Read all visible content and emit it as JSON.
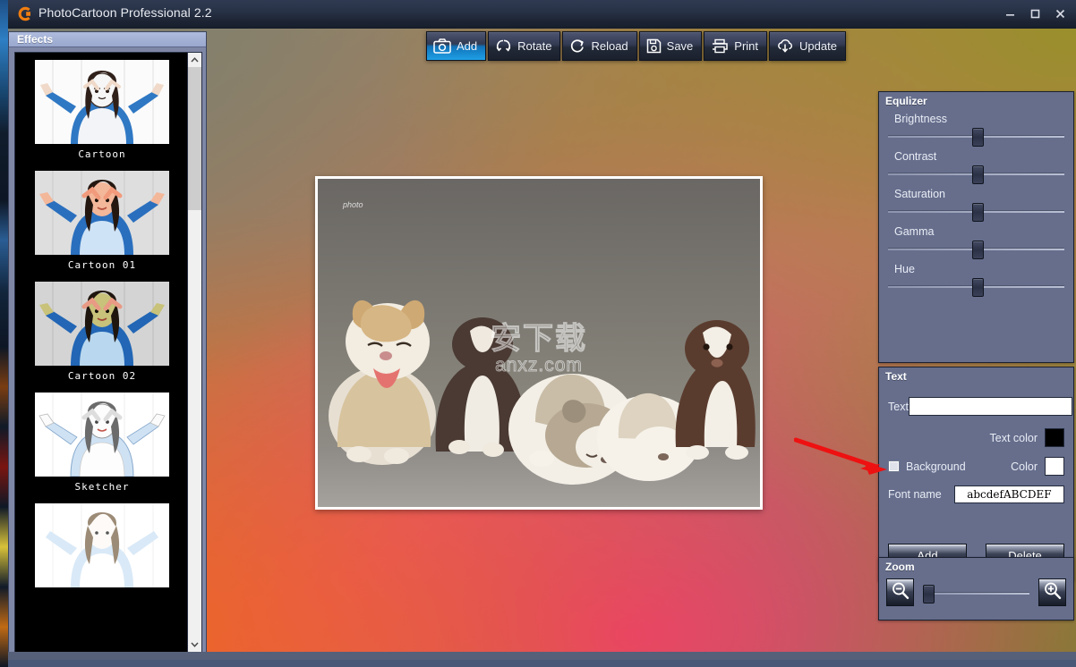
{
  "window": {
    "title": "PhotoCartoon Professional 2.2",
    "logo_icon": "app-logo-icon",
    "minimize_label": "–",
    "maximize_label": "□",
    "close_label": "✕"
  },
  "toolbar": {
    "buttons": [
      {
        "label": "Add",
        "icon": "camera-icon",
        "active": true
      },
      {
        "label": "Rotate",
        "icon": "rotate-icon",
        "active": false
      },
      {
        "label": "Reload",
        "icon": "reload-icon",
        "active": false
      },
      {
        "label": "Save",
        "icon": "floppy-icon",
        "active": false
      },
      {
        "label": "Print",
        "icon": "printer-icon",
        "active": false
      },
      {
        "label": "Update",
        "icon": "cloud-download-icon",
        "active": false
      }
    ]
  },
  "effects": {
    "header": "Effects",
    "items": [
      {
        "label": "Cartoon"
      },
      {
        "label": "Cartoon 01"
      },
      {
        "label": "Cartoon 02"
      },
      {
        "label": "Sketcher"
      },
      {
        "label": ""
      }
    ],
    "scroll_up_icon": "chevron-up-icon",
    "scroll_down_icon": "chevron-down-icon"
  },
  "canvas": {
    "watermark_main": "安下载",
    "watermark_sub": "anxz.com",
    "signature": "photo"
  },
  "equalizer": {
    "title": "Equlizer",
    "sliders": [
      {
        "label": "Brightness",
        "value": 50
      },
      {
        "label": "Contrast",
        "value": 50
      },
      {
        "label": "Saturation",
        "value": 50
      },
      {
        "label": "Gamma",
        "value": 50
      },
      {
        "label": "Hue",
        "value": 50
      }
    ]
  },
  "text_panel": {
    "title": "Text",
    "text_label": "Text",
    "text_value": "",
    "text_color_label": "Text color",
    "text_color": "#000000",
    "background_label": "Background",
    "background_checked": false,
    "color_label": "Color",
    "background_color": "#ffffff",
    "font_name_label": "Font name",
    "font_sample": "abcdefABCDEF",
    "add_label": "Add",
    "delete_label": "Delete"
  },
  "zoom_panel": {
    "title": "Zoom",
    "zoom_out_icon": "magnifier-minus-icon",
    "zoom_in_icon": "magnifier-plus-icon",
    "value": 0
  },
  "annotation": {
    "arrow_icon": "red-arrow-icon",
    "arrow_color": "#ee1111"
  },
  "colors": {
    "panel_bg": "#666e8c",
    "accent_blue": "#1fa0e6",
    "effects_header": "#9aa8ce"
  }
}
